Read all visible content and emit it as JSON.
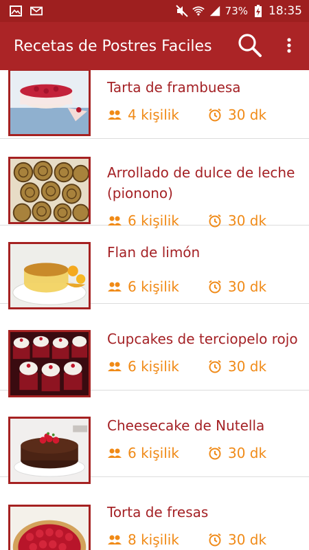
{
  "status_bar": {
    "battery": "73%",
    "time": "18:35",
    "icons": [
      "image-notification-icon",
      "mail-icon",
      "mute-icon",
      "wifi-icon",
      "signal-icon",
      "battery-charging-icon"
    ]
  },
  "app_bar": {
    "title": "Recetas de Postres Faciles",
    "search_icon": "search-icon",
    "menu_icon": "more-vert-icon"
  },
  "colors": {
    "accent": "#ab2426",
    "status": "#9e1f1f",
    "title_text": "#a42125",
    "meta_text": "#f08a17"
  },
  "recipes": [
    {
      "title": "Tarta de frambuesa",
      "servings": "4 kişilik",
      "time": "30 dk"
    },
    {
      "title": "Arrollado de dulce de leche (pionono)",
      "servings": "6 kişilik",
      "time": "30 dk"
    },
    {
      "title": "Flan de limón",
      "servings": "6 kişilik",
      "time": "30 dk"
    },
    {
      "title": "Cupcakes de terciopelo rojo",
      "servings": "6 kişilik",
      "time": "30 dk"
    },
    {
      "title": "Cheesecake de Nutella",
      "servings": "6 kişilik",
      "time": "30 dk"
    },
    {
      "title": "Torta de fresas",
      "servings": "8 kişilik",
      "time": "30 dk"
    }
  ]
}
